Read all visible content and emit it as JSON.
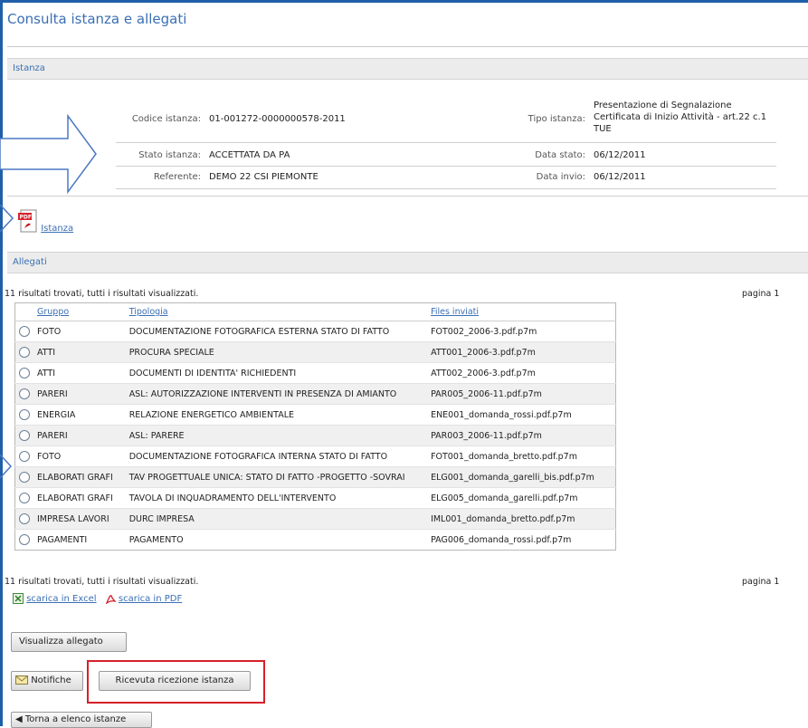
{
  "page": {
    "title": "Consulta istanza e allegati"
  },
  "istanza_section": {
    "header": "Istanza",
    "codice_label": "Codice istanza:",
    "codice_value": "01-001272-0000000578-2011",
    "tipo_label": "Tipo istanza:",
    "tipo_value_lines": [
      "Presentazione di Segnalazione",
      "Certificata di Inizio Attività - art.22 c.1",
      "TUE"
    ],
    "stato_label": "Stato istanza:",
    "stato_value": "ACCETTATA DA PA",
    "data_stato_label": "Data stato:",
    "data_stato_value": "06/12/2011",
    "referente_label": "Referente:",
    "referente_value": "DEMO 22 CSI PIEMONTE",
    "data_invio_label": "Data invio:",
    "data_invio_value": "06/12/2011",
    "pdf_link": "Istanza",
    "pdf_icon": "pdf-icon",
    "pdf_icon_text": "PDF"
  },
  "allegati_section": {
    "header": "Allegati",
    "results_text": "11 risultati trovati, tutti i risultati visualizzati.",
    "page_text": "pagina 1",
    "columns": [
      "Gruppo",
      "Tipologia",
      "Files inviati"
    ],
    "rows": [
      {
        "gruppo": "FOTO",
        "tipologia": "DOCUMENTAZIONE FOTOGRAFICA ESTERNA STATO DI FATTO",
        "file": "FOT002_2006-3.pdf.p7m"
      },
      {
        "gruppo": "ATTI",
        "tipologia": "PROCURA SPECIALE",
        "file": "ATT001_2006-3.pdf.p7m"
      },
      {
        "gruppo": "ATTI",
        "tipologia": "DOCUMENTI DI IDENTITA' RICHIEDENTI",
        "file": "ATT002_2006-3.pdf.p7m"
      },
      {
        "gruppo": "PARERI",
        "tipologia": "ASL: AUTORIZZAZIONE INTERVENTI IN PRESENZA DI AMIANTO",
        "file": "PAR005_2006-11.pdf.p7m"
      },
      {
        "gruppo": "ENERGIA",
        "tipologia": "RELAZIONE ENERGETICO AMBIENTALE",
        "file": "ENE001_domanda_rossi.pdf.p7m"
      },
      {
        "gruppo": "PARERI",
        "tipologia": "ASL: PARERE",
        "file": "PAR003_2006-11.pdf.p7m"
      },
      {
        "gruppo": "FOTO",
        "tipologia": "DOCUMENTAZIONE FOTOGRAFICA INTERNA STATO DI FATTO",
        "file": "FOT001_domanda_bretto.pdf.p7m"
      },
      {
        "gruppo": "ELABORATI GRAFI",
        "tipologia": "TAV PROGETTUALE UNICA: STATO DI FATTO -PROGETTO -SOVRAI",
        "file": "ELG001_domanda_garelli_bis.pdf.p7m"
      },
      {
        "gruppo": "ELABORATI GRAFI",
        "tipologia": "TAVOLA DI INQUADRAMENTO DELL'INTERVENTO",
        "file": "ELG005_domanda_garelli.pdf.p7m"
      },
      {
        "gruppo": "IMPRESA LAVORI",
        "tipologia": "DURC IMPRESA",
        "file": "IML001_domanda_bretto.pdf.p7m"
      },
      {
        "gruppo": "PAGAMENTI",
        "tipologia": "PAGAMENTO",
        "file": "PAG006_domanda_rossi.pdf.p7m"
      }
    ],
    "excel_link": "scarica in Excel",
    "pdf_download_link": "scarica in PDF"
  },
  "buttons": {
    "visualizza": "Visualizza allegato",
    "notifiche": "Notifiche",
    "ricevuta": "Ricevuta ricezione istanza",
    "torna": "Torna a elenco istanze"
  },
  "colors": {
    "accent": "#3a6fb4",
    "frame": "#1f5fa8",
    "highlight": "#d6202a"
  }
}
